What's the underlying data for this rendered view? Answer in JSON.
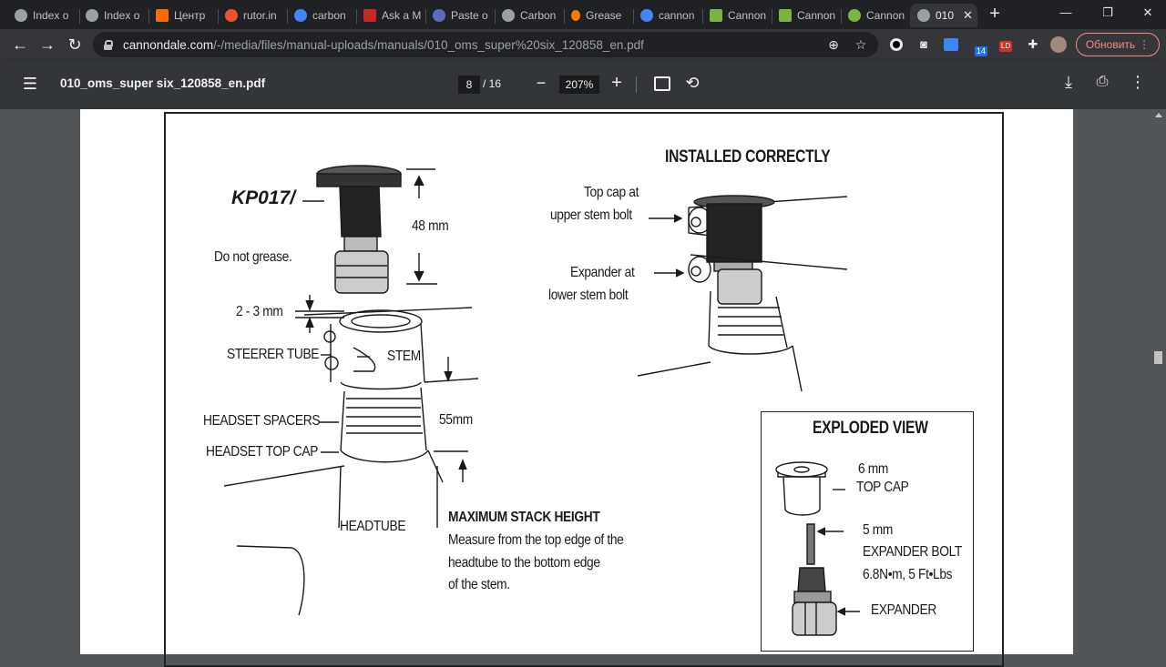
{
  "browser": {
    "tabs": [
      {
        "title": "Index o",
        "icon": "globe-icon",
        "color": "#9aa0a6"
      },
      {
        "title": "Index o",
        "icon": "globe-icon",
        "color": "#9aa0a6"
      },
      {
        "title": "Центр",
        "icon": "bars-icon",
        "color": "#ff6a00"
      },
      {
        "title": "rutor.in",
        "icon": "rutor-icon",
        "color": "#e8542d"
      },
      {
        "title": "carbon",
        "icon": "google-icon",
        "color": "#4285f4"
      },
      {
        "title": "Ask a M",
        "icon": "forum-icon",
        "color": "#c62828"
      },
      {
        "title": "Paste o",
        "icon": "paste-icon",
        "color": "#5c6bc0"
      },
      {
        "title": "Carbon",
        "icon": "globe-icon",
        "color": "#9aa0a6"
      },
      {
        "title": "Grease",
        "icon": "grease-icon",
        "color": "#f57c00"
      },
      {
        "title": "cannon",
        "icon": "google-icon",
        "color": "#4285f4"
      },
      {
        "title": "Cannon",
        "icon": "cannondale-icon",
        "color": "#7cb342"
      },
      {
        "title": "Cannon",
        "icon": "cannondale-icon",
        "color": "#7cb342"
      },
      {
        "title": "Cannon",
        "icon": "cannondale-round-icon",
        "color": "#7cb342"
      },
      {
        "title": "010",
        "icon": "globe-icon",
        "color": "#9aa0a6",
        "active": true
      }
    ],
    "url_host": "cannondale.com",
    "url_path": "/-/media/files/manual-uploads/manuals/010_oms_super%20six_120858_en.pdf",
    "extension_badge": "14",
    "ext_ld": "LD",
    "update_label": "Обновить"
  },
  "pdf": {
    "filename": "010_oms_super six_120858_en.pdf",
    "page_current": "8",
    "page_total": "/ 16",
    "zoom": "207%"
  },
  "doc": {
    "part_no": "KP017/",
    "do_not_grease": "Do not grease.",
    "dim_48": "48 mm",
    "dim_2_3": "2 - 3 mm",
    "steerer_tube": "STEERER TUBE",
    "stem": "STEM",
    "dim_55": "55mm",
    "headset_spacers": "HEADSET SPACERS",
    "headset_top_cap": "HEADSET TOP CAP",
    "headtube": "HEADTUBE",
    "max_stack_title": "MAXIMUM STACK HEIGHT",
    "max_stack_line1": "Measure from the top edge of the",
    "max_stack_line2": "headtube to the bottom edge",
    "max_stack_line3": "of the stem.",
    "installed_title": "INSTALLED CORRECTLY",
    "topcap_line1": "Top cap at",
    "topcap_line2": "upper stem bolt",
    "expander_line1": "Expander at",
    "expander_line2": "lower stem bolt",
    "exploded_title": "EXPLODED VIEW",
    "mm6": "6 mm",
    "top_cap": "TOP CAP",
    "mm5": "5 mm",
    "expander_bolt": "EXPANDER BOLT",
    "torque": "6.8N•m, 5 Ft•Lbs",
    "expander": "EXPANDER"
  }
}
